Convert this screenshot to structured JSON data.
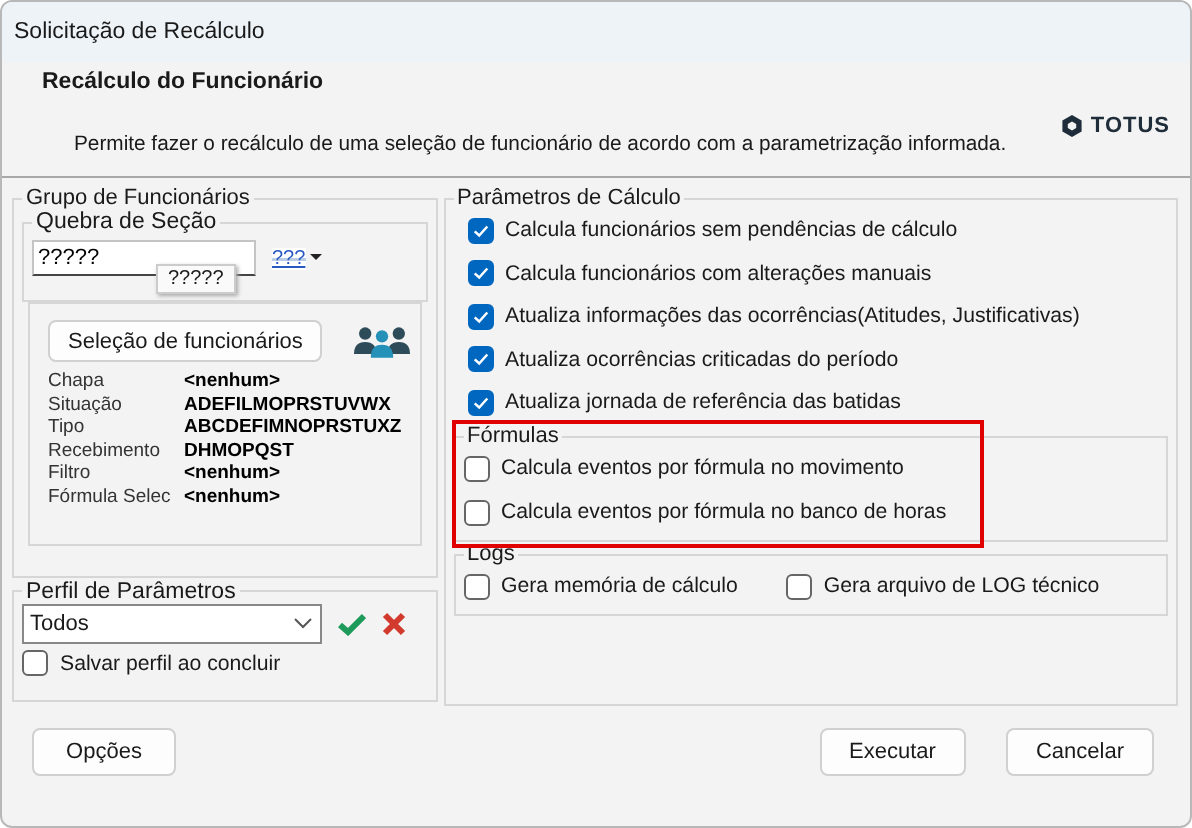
{
  "window": {
    "title": "Solicitação de Recálculo"
  },
  "header": {
    "title": "Recálculo do Funcionário",
    "description": "Permite fazer o recálculo de uma seleção de funcionário de acordo com a parametrização informada.",
    "logo_text": "TOTUS"
  },
  "employee_group": {
    "title": "Grupo de Funcionários",
    "section_break": {
      "title": "Quebra de Seção",
      "value": "?????",
      "tooltip": "?????",
      "picker_label": "???"
    },
    "select_button": "Seleção de funcionários",
    "fields": [
      {
        "label": "Chapa",
        "value": "<nenhum>"
      },
      {
        "label": "Situação",
        "value": "ADEFILMOPRSTUVWX"
      },
      {
        "label": "Tipo",
        "value": "ABCDEFIMNOPRSTUXZ"
      },
      {
        "label": "Recebimento",
        "value": "DHMOPQST"
      },
      {
        "label": "Filtro",
        "value": "<nenhum>"
      },
      {
        "label": "Fórmula Selec",
        "value": "<nenhum>"
      }
    ]
  },
  "parameter_profile": {
    "title": "Perfil de Parâmetros",
    "value": "Todos",
    "save_option": {
      "label": "Salvar perfil ao concluir",
      "checked": false
    }
  },
  "calc_params": {
    "title": "Parâmetros de Cálculo",
    "options": [
      {
        "label": "Calcula funcionários sem pendências de cálculo",
        "checked": true
      },
      {
        "label": "Calcula funcionários com alterações manuais",
        "checked": true
      },
      {
        "label": "Atualiza informações das ocorrências(Atitudes, Justificativas)",
        "checked": true
      },
      {
        "label": "Atualiza ocorrências criticadas do período",
        "checked": true
      },
      {
        "label": "Atualiza jornada de referência das batidas",
        "checked": true
      }
    ],
    "formulas": {
      "title": "Fórmulas",
      "highlighted": true,
      "options": [
        {
          "label": "Calcula eventos por fórmula no movimento",
          "checked": false
        },
        {
          "label": "Calcula eventos por fórmula no banco de horas",
          "checked": false
        }
      ]
    },
    "logs": {
      "title": "Logs",
      "options": [
        {
          "label": "Gera memória de cálculo",
          "checked": false
        },
        {
          "label": "Gera arquivo de LOG técnico",
          "checked": false
        }
      ]
    }
  },
  "left_buttons": [
    "Opções"
  ],
  "right_buttons": [
    "Executar",
    "Cancelar"
  ]
}
